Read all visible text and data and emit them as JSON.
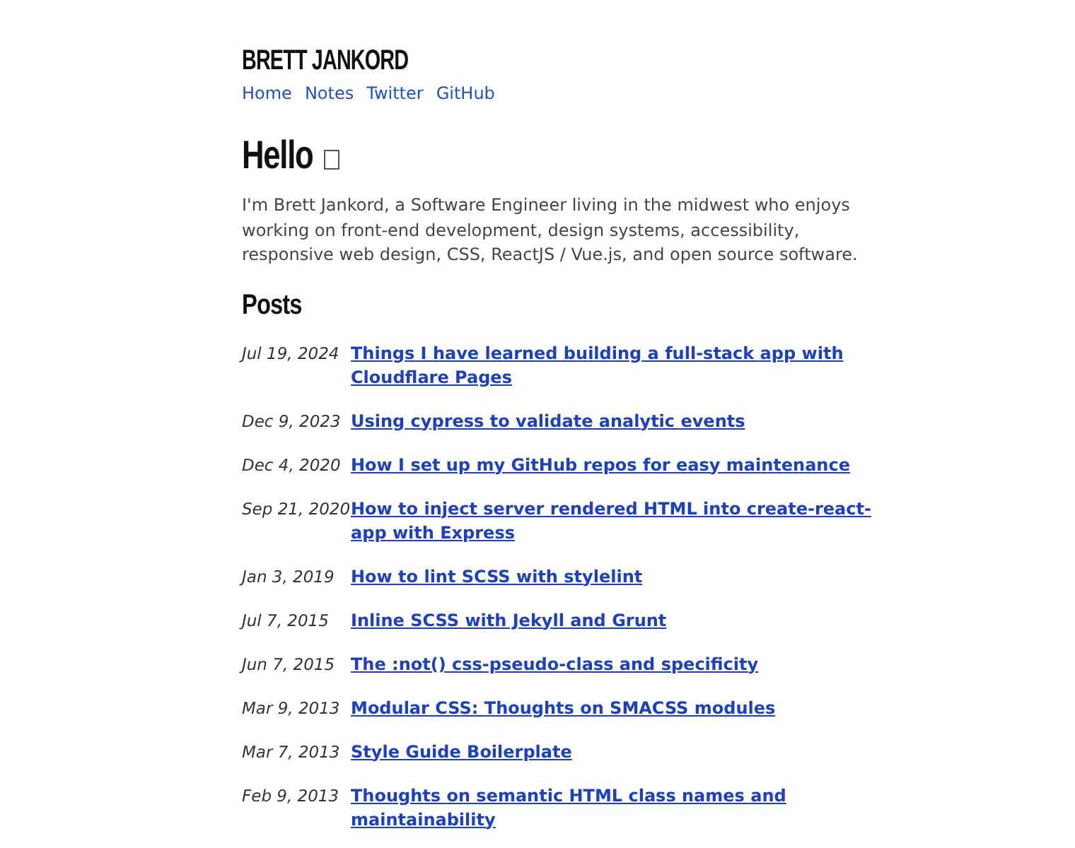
{
  "site_title": "BRETT JANKORD",
  "nav": [
    "Home",
    "Notes",
    "Twitter",
    "GitHub"
  ],
  "heading": "Hello",
  "intro": "I'm Brett Jankord, a Software Engineer living in the midwest who enjoys working on front-end development, design systems, accessibility, responsive web design, CSS, ReactJS / Vue.js, and open source software.",
  "posts_heading": "Posts",
  "posts": [
    {
      "date": "Jul 19, 2024",
      "title": "Things I have learned building a full-stack app with Cloudflare Pages"
    },
    {
      "date": "Dec 9, 2023",
      "title": "Using cypress to validate analytic events"
    },
    {
      "date": "Dec 4, 2020",
      "title": "How I set up my GitHub repos for easy maintenance"
    },
    {
      "date": "Sep 21, 2020",
      "title": "How to inject server rendered HTML into create-react-app with Express"
    },
    {
      "date": "Jan 3, 2019",
      "title": "How to lint SCSS with stylelint"
    },
    {
      "date": "Jul 7, 2015",
      "title": "Inline SCSS with Jekyll and Grunt"
    },
    {
      "date": "Jun 7, 2015",
      "title": "The :not() css-pseudo-class and specificity"
    },
    {
      "date": "Mar 9, 2013",
      "title": "Modular CSS: Thoughts on SMACSS modules"
    },
    {
      "date": "Mar 7, 2013",
      "title": "Style Guide Boilerplate"
    },
    {
      "date": "Feb 9, 2013",
      "title": "Thoughts on semantic HTML class names and maintainability"
    }
  ]
}
